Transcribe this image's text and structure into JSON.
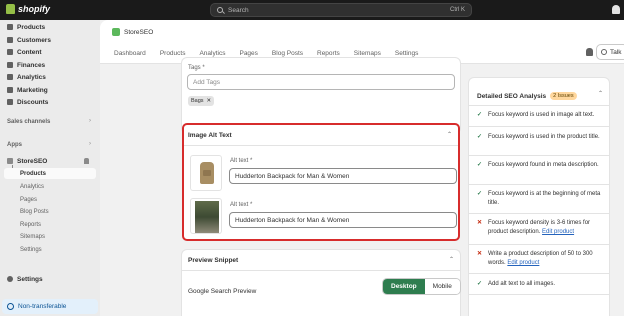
{
  "topbar": {
    "brand": "shopify",
    "search_placeholder": "Search",
    "shortcut": "Ctrl K"
  },
  "sidebar": {
    "items": [
      {
        "label": "Products"
      },
      {
        "label": "Customers"
      },
      {
        "label": "Content"
      },
      {
        "label": "Finances"
      },
      {
        "label": "Analytics"
      },
      {
        "label": "Marketing"
      },
      {
        "label": "Discounts"
      }
    ],
    "sales_channels": "Sales channels",
    "apps": "Apps",
    "app_name": "StoreSEO",
    "app_sub": [
      {
        "label": "Products"
      },
      {
        "label": "Analytics"
      },
      {
        "label": "Pages"
      },
      {
        "label": "Blog Posts"
      },
      {
        "label": "Reports"
      },
      {
        "label": "Sitemaps"
      },
      {
        "label": "Settings"
      }
    ],
    "settings": "Settings",
    "non_transferable": "Non-transferable"
  },
  "app": {
    "title": "StoreSEO",
    "tabs": [
      {
        "label": "Dashboard"
      },
      {
        "label": "Products"
      },
      {
        "label": "Analytics"
      },
      {
        "label": "Pages"
      },
      {
        "label": "Blog Posts"
      },
      {
        "label": "Reports"
      },
      {
        "label": "Sitemaps"
      },
      {
        "label": "Settings"
      }
    ],
    "talk_label": "Talk"
  },
  "tags": {
    "label": "Tags *",
    "placeholder": "Add Tags",
    "chip": "Bags"
  },
  "alt_text": {
    "title": "Image Alt Text",
    "images": [
      {
        "label": "Alt text *",
        "value": "Hudderton Backpack for Man & Women"
      },
      {
        "label": "Alt text *",
        "value": "Hudderton Backpack for Man & Women"
      }
    ]
  },
  "preview": {
    "title": "Preview Snippet",
    "google_label": "Google Search Preview",
    "desktop": "Desktop",
    "mobile": "Mobile"
  },
  "seo": {
    "title": "Detailed SEO Analysis",
    "badge": "2 Issues",
    "items": [
      {
        "status": "ok",
        "text": "Focus keyword is used in image alt text."
      },
      {
        "status": "ok",
        "text": "Focus keyword is used in the product title."
      },
      {
        "status": "ok",
        "text": "Focus keyword found in meta description."
      },
      {
        "status": "ok",
        "text": "Focus keyword is at the beginning of meta title."
      },
      {
        "status": "bad",
        "text": "Focus keyword density is 3-6 times for product description.",
        "link": "Edit product"
      },
      {
        "status": "bad",
        "text": "Write a product description of 50 to 300 words.",
        "link": "Edit product"
      },
      {
        "status": "ok",
        "text": "Add alt text to all images."
      }
    ]
  },
  "colors": {
    "primary": "#2e7d4f",
    "highlight_border": "#d72c2c",
    "topbar": "#1a1a1a"
  }
}
